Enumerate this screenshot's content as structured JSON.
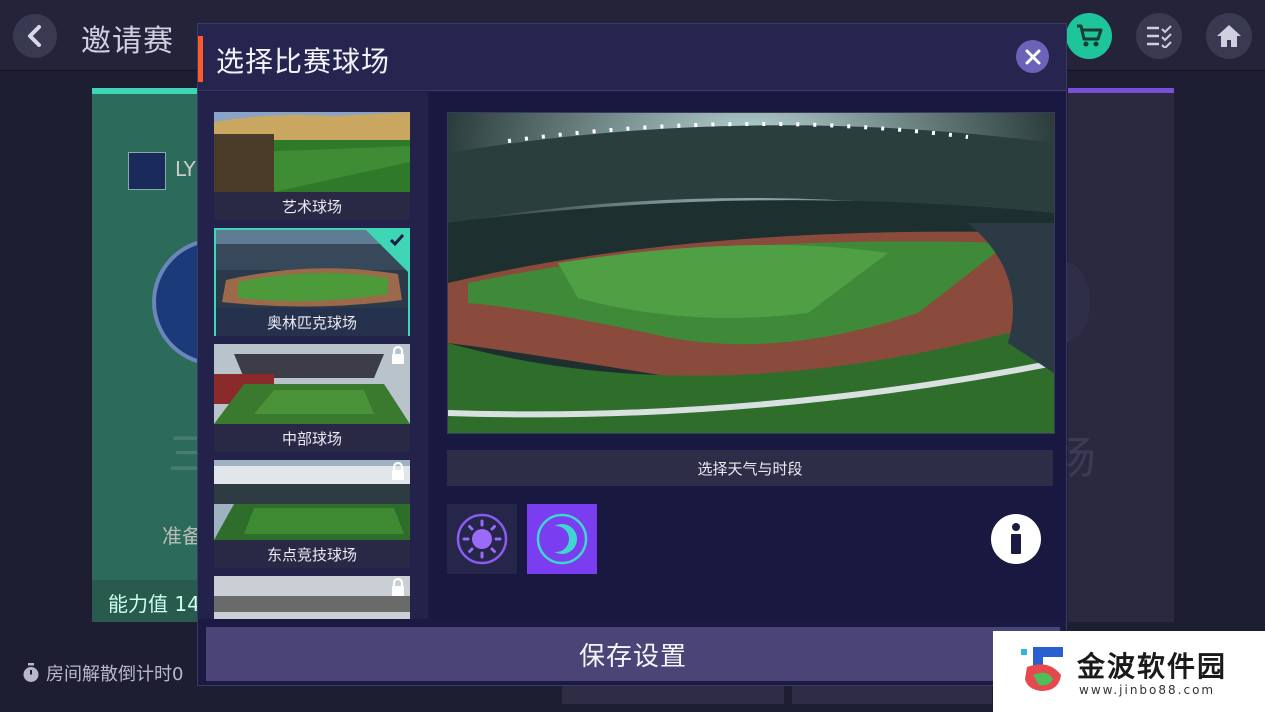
{
  "background": {
    "title": "邀请赛",
    "team_name": "LY",
    "ready_text": "准备",
    "power_text": "能力值 14",
    "countdown_text": "房间解散倒计时0",
    "left_ghost_text": "三",
    "right_ghost_text": "场"
  },
  "modal": {
    "title": "选择比赛球场",
    "stadiums": [
      {
        "label": "艺术球场",
        "locked": false,
        "selected": false
      },
      {
        "label": "奥林匹克球场",
        "locked": false,
        "selected": true
      },
      {
        "label": "中部球场",
        "locked": true,
        "selected": false
      },
      {
        "label": "东点竞技球场",
        "locked": true,
        "selected": false
      },
      {
        "label": "",
        "locked": true,
        "selected": false
      }
    ],
    "weather_label": "选择天气与时段",
    "save_label": "保存设置"
  },
  "colors": {
    "accent_orange": "#ff5a2a",
    "selected_teal": "#3fd6b5",
    "night_purple": "#7b3df0",
    "save_button": "#4a4576",
    "cart_green": "#1fc59a"
  },
  "icons": [
    "back-icon",
    "cart-icon",
    "checklist-icon",
    "home-icon",
    "close-icon",
    "lock-icon",
    "check-icon",
    "sun-icon",
    "moon-icon",
    "info-icon",
    "timer-icon"
  ],
  "watermark": {
    "text": "金波软件园",
    "url": "www.jinbo88.com"
  }
}
